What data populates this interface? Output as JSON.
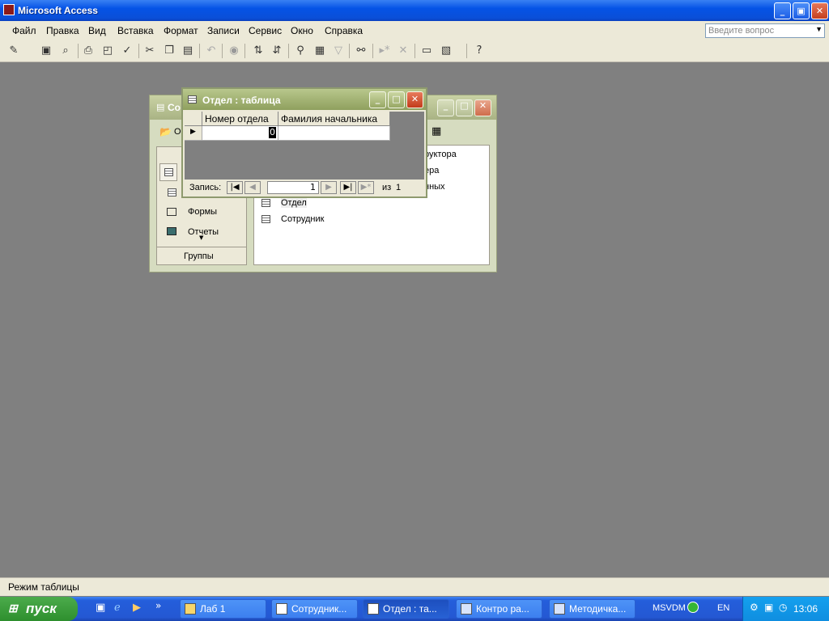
{
  "app": {
    "title": "Microsoft Access"
  },
  "menu": {
    "items": [
      "Файл",
      "Правка",
      "Вид",
      "Вставка",
      "Формат",
      "Записи",
      "Сервис",
      "Окно",
      "Справка"
    ],
    "ask_placeholder": "Введите вопрос"
  },
  "db_window": {
    "title_fragment": "Со",
    "toolbar_fragment": "О",
    "left_items": [
      "Формы",
      "Отчеты"
    ],
    "groups_label": "Группы",
    "objects": [
      "руктора",
      "ера",
      "нных",
      "Отдел",
      "Сотрудник"
    ]
  },
  "table_window": {
    "title": "Отдел : таблица",
    "columns": [
      "Номер отдела",
      "Фамилия начальника"
    ],
    "cell_value": "0",
    "nav": {
      "label": "Запись:",
      "current": "1",
      "of_label": "из",
      "total": "1"
    }
  },
  "status": {
    "text": "Режим таблицы"
  },
  "taskbar": {
    "start_label": "пуск",
    "tasks": [
      "Лаб 1",
      "Сотрудник...",
      "Отдел : та...",
      "Контро ра...",
      "Методичка..."
    ],
    "tray": {
      "msvdm": "MSVDM",
      "lang": "EN",
      "time": "13:06"
    }
  }
}
